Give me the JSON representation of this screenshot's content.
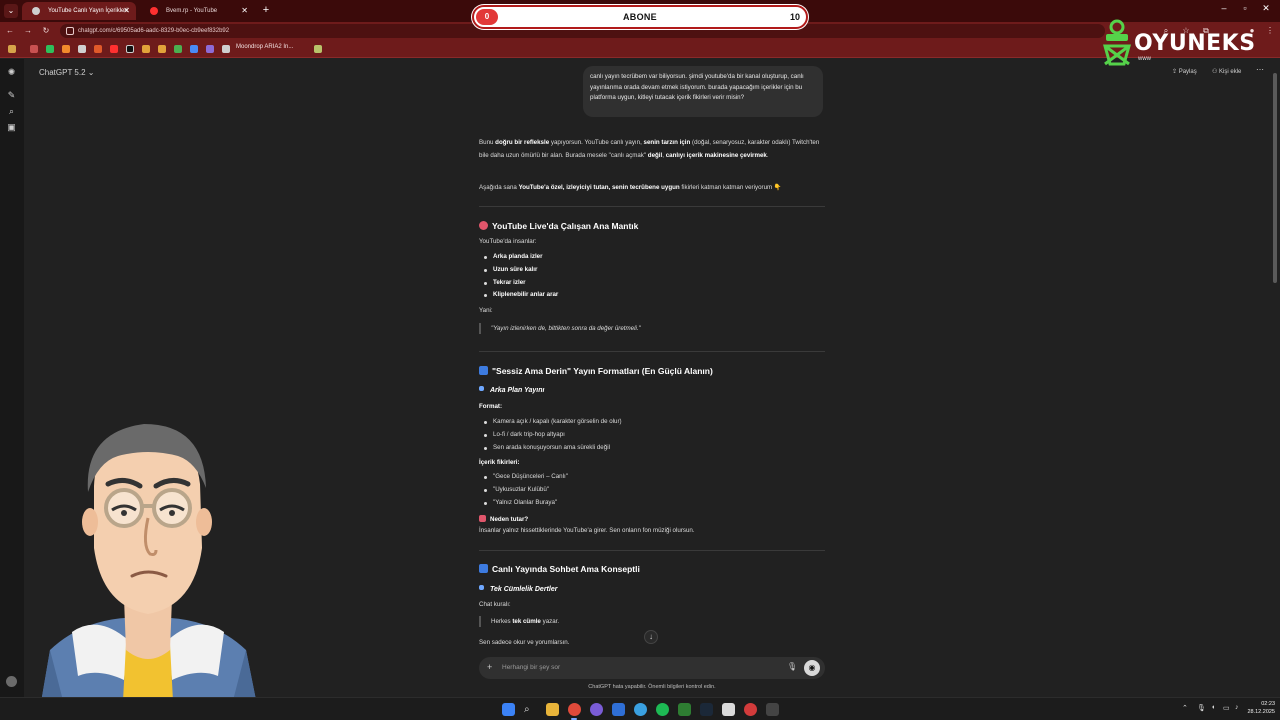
{
  "browser": {
    "tabs": [
      {
        "title": "YouTube Canlı Yayın İçerikleri",
        "active": true
      },
      {
        "title": "Bvem.rp - YouTube",
        "active": false
      }
    ],
    "url": "chatgpt.com/c/69505ad6-aadc-8329-b0ec-cb9eef832b92",
    "bookmark_label": "Moondrop ARIA2 In..."
  },
  "overlay": {
    "subscribe_label": "ABONE",
    "subscribe_start": "0",
    "subscribe_goal": "10",
    "brand_name": "OYUNEKS",
    "brand_sub": "www"
  },
  "app": {
    "model": "ChatGPT 5.2 ⌄",
    "share_label": "Paylaş",
    "add_people_label": "Kişi ekle",
    "user_message": "canlı yayın tecrübem var biliyorsun. şimdi youtube'da bir kanal oluşturup, canlı yayınlarıma orada devam etmek istiyorum. burada yapacağım içerikler için bu platforma uygun, kitleyi tutacak içerik fikirleri verir misin?",
    "intro_1a": "Bunu ",
    "intro_1b": "doğru bir refleksle",
    "intro_1c": " yapıyorsun. YouTube canlı yayın, ",
    "intro_1d": "senin tarzın için",
    "intro_1e": " (doğal, senaryosuz, karakter odaklı) Twitch'ten bile daha uzun ömürlü bir alan. Burada mesele \"canlı açmak\" ",
    "intro_1f": "değil",
    "intro_1g": ", ",
    "intro_1h": "canlıyı içerik makinesine çevirmek",
    "intro_1i": ".",
    "intro_2a": "Aşağıda sana ",
    "intro_2b": "YouTube'a özel, izleyiciyi tutan, senin tecrübene uygun",
    "intro_2c": " fikirleri katman katman veriyorum 👇",
    "section0_title": "YouTube Live'da Çalışan Ana Mantık",
    "section0_intro": "YouTube'da insanlar:",
    "section0_items": [
      "Arka planda izler",
      "Uzun süre kalır",
      "Tekrar izler",
      "Kliplenebilir anlar arar"
    ],
    "section0_yani": "Yani:",
    "section0_quote": "\"Yayın izlenirken de, bittikten sonra da değer üretmeli.\"",
    "section1_title": "\"Sessiz Ama Derin\" Yayın Formatları (En Güçlü Alanın)",
    "section1_sub": "Arka Plan Yayını",
    "section1_format_label": "Format:",
    "section1_format_items": [
      "Kamera açık / kapalı (karakter görselin de olur)",
      "Lo-fi / dark trip-hop altyapı",
      "Sen arada konuşuyorsun ama sürekli değil"
    ],
    "section1_ideas_label": "İçerik fikirleri:",
    "section1_ideas_items": [
      "\"Gece Düşünceleri – Canlı\"",
      "\"Uykusuzlar Kulübü\"",
      "\"Yalnız Olanlar Buraya\""
    ],
    "section1_why_label": "Neden tutar?",
    "section1_why_text": "İnsanlar yalnız hissettiklerinde YouTube'a girer. Sen onların fon müziği olursun.",
    "section2_title": "Canlı Yayında Sohbet Ama Konseptli",
    "section2_sub": "Tek Cümlelik Dertler",
    "section2_chat_label": "Chat kuralı:",
    "section2_quote_a": "Herkes ",
    "section2_quote_b": "tek cümle",
    "section2_quote_c": " yazar.",
    "section2_after": "Sen sadece okur ve yorumlarsın.",
    "composer_placeholder": "Herhangi bir şey sor",
    "disclaimer": "ChatGPT hata yapabilir. Önemli bilgileri kontrol edin."
  },
  "taskbar": {
    "time": "02:23",
    "date": "28.12.2025"
  }
}
